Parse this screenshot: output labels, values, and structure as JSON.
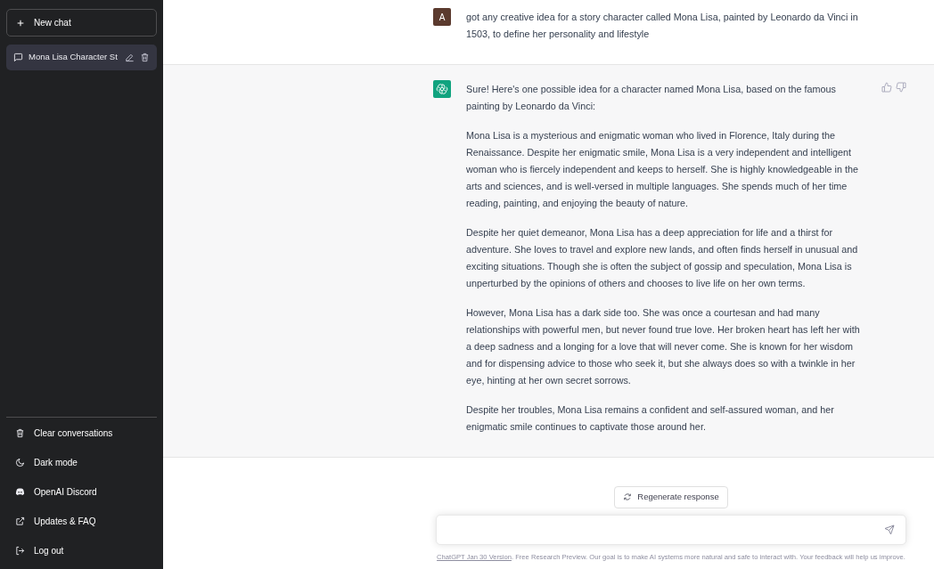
{
  "sidebar": {
    "new_chat": "New chat",
    "conversations": [
      {
        "title": "Mona Lisa Character St",
        "selected": true
      }
    ],
    "menu": [
      {
        "kind": "trash",
        "label": "Clear conversations"
      },
      {
        "kind": "moon",
        "label": "Dark mode"
      },
      {
        "kind": "discord",
        "label": "OpenAI Discord"
      },
      {
        "kind": "external",
        "label": "Updates & FAQ"
      },
      {
        "kind": "logout",
        "label": "Log out"
      }
    ]
  },
  "messages": [
    {
      "kind": "user",
      "avatar": "A",
      "paragraphs": [
        "got any creative idea for a story character called Mona Lisa, painted by Leonardo da Vinci in 1503, to define her personality and lifestyle"
      ]
    },
    {
      "kind": "assistant",
      "paragraphs": [
        "Sure! Here's one possible idea for a character named Mona Lisa, based on the famous painting by Leonardo da Vinci:",
        "Mona Lisa is a mysterious and enigmatic woman who lived in Florence, Italy during the Renaissance. Despite her enigmatic smile, Mona Lisa is a very independent and intelligent woman who is fiercely independent and keeps to herself. She is highly knowledgeable in the arts and sciences, and is well-versed in multiple languages. She spends much of her time reading, painting, and enjoying the beauty of nature.",
        "Despite her quiet demeanor, Mona Lisa has a deep appreciation for life and a thirst for adventure. She loves to travel and explore new lands, and often finds herself in unusual and exciting situations. Though she is often the subject of gossip and speculation, Mona Lisa is unperturbed by the opinions of others and chooses to live life on her own terms.",
        "However, Mona Lisa has a dark side too. She was once a courtesan and had many relationships with powerful men, but never found true love. Her broken heart has left her with a deep sadness and a longing for a love that will never come. She is known for her wisdom and for dispensing advice to those who seek it, but she always does so with a twinkle in her eye, hinting at her own secret sorrows.",
        "Despite her troubles, Mona Lisa remains a confident and self-assured woman, and her enigmatic smile continues to captivate those around her."
      ]
    }
  ],
  "regenerate": "Regenerate response",
  "footer": {
    "link": "ChatGPT Jan 30 Version",
    "text": ". Free Research Preview. Our goal is to make AI systems more natural and safe to interact with. Your feedback will help us improve."
  }
}
